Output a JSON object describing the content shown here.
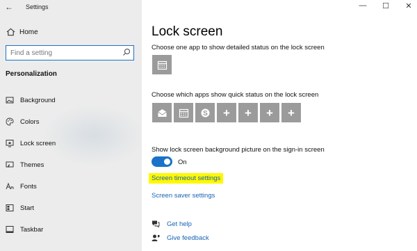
{
  "window": {
    "app_title": "Settings",
    "controls": {
      "minimize": "—",
      "maximize": "☐",
      "close": "✕"
    }
  },
  "sidebar": {
    "home_label": "Home",
    "search_placeholder": "Find a setting",
    "section_title": "Personalization",
    "items": [
      {
        "label": "Background",
        "icon": "picture-icon"
      },
      {
        "label": "Colors",
        "icon": "palette-icon"
      },
      {
        "label": "Lock screen",
        "icon": "lock-screen-icon"
      },
      {
        "label": "Themes",
        "icon": "brush-icon"
      },
      {
        "label": "Fonts",
        "icon": "font-icon"
      },
      {
        "label": "Start",
        "icon": "start-icon"
      },
      {
        "label": "Taskbar",
        "icon": "taskbar-icon"
      }
    ]
  },
  "main": {
    "title": "Lock screen",
    "detailed_status_desc": "Choose one app to show detailed status on the lock screen",
    "quick_status_desc": "Choose which apps show quick status on the lock screen",
    "quick_status_tiles": [
      {
        "kind": "app",
        "icon": "mail-icon"
      },
      {
        "kind": "app",
        "icon": "calendar-icon"
      },
      {
        "kind": "app",
        "icon": "skype-icon"
      },
      {
        "kind": "add",
        "label": "+"
      },
      {
        "kind": "add",
        "label": "+"
      },
      {
        "kind": "add",
        "label": "+"
      },
      {
        "kind": "add",
        "label": "+"
      }
    ],
    "signin_background_desc": "Show lock screen background picture on the sign-in screen",
    "toggle_state": "On",
    "toggle_on": true,
    "screen_timeout_link": "Screen timeout settings",
    "screen_saver_link": "Screen saver settings",
    "get_help": "Get help",
    "give_feedback": "Give feedback"
  },
  "colors": {
    "accent": "#1a73c8",
    "link": "#1664b4",
    "tile": "#9b9b9b",
    "highlight": "#fff800",
    "sidebar_bg": "#ececec"
  }
}
